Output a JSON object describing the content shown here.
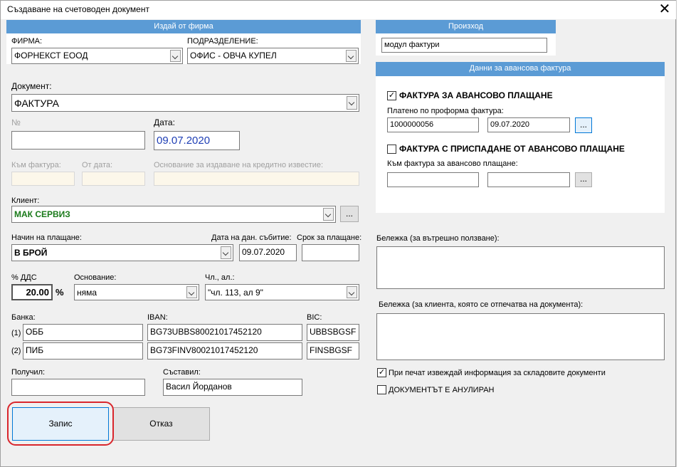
{
  "window": {
    "title": "Създаване на счетоводен документ"
  },
  "issued_from": {
    "header": "Издай от фирма",
    "firm_label": "ФИРМА:",
    "firm_value": "ФОРНЕКСТ ЕООД",
    "division_label": "ПОДРАЗДЕЛЕНИЕ:",
    "division_value": "ОФИС - ОВЧА КУПЕЛ"
  },
  "document": {
    "label": "Документ:",
    "value": "ФАКТУРА",
    "number_label": "№",
    "number_value": "",
    "date_label": "Дата:",
    "date_value": "09.07.2020",
    "to_invoice_label": "Към фактура:",
    "from_date_label": "От дата:",
    "credit_reason_label": "Основание за издаване на кредитно известие:"
  },
  "client": {
    "label": "Клиент:",
    "value": "МАК СЕРВИЗ",
    "browse": "..."
  },
  "payment": {
    "method_label": "Начин на плащане:",
    "method_value": "В БРОЙ",
    "tax_event_label": "Дата на дан. събитие:",
    "tax_event_value": "09.07.2020",
    "due_label": "Срок за плащане:",
    "due_value": ""
  },
  "vat": {
    "percent_label": "% ДДС",
    "percent_value": "20.00",
    "percent_sign": "%",
    "basis_label": "Основание:",
    "basis_value": "няма",
    "article_label": "Чл., ал.:",
    "article_value": "\"чл. 113, ал 9\""
  },
  "bank": {
    "bank_label": "Банка:",
    "iban_label": "IBAN:",
    "bic_label": "BIC:",
    "rows": [
      {
        "idx": "(1)",
        "bank": "ОББ",
        "iban": "BG73UBBS80021017452120",
        "bic": "UBBSBGSF"
      },
      {
        "idx": "(2)",
        "bank": "ПИБ",
        "iban": "BG73FINV80021017452120",
        "bic": "FINSBGSF"
      }
    ]
  },
  "received_by": {
    "label": "Получил:",
    "value": ""
  },
  "compiled_by": {
    "label": "Съставил:",
    "value": "Васил Йорданов"
  },
  "buttons": {
    "save": "Запис",
    "cancel": "Отказ"
  },
  "origin": {
    "header": "Произход",
    "value": "модул фактури"
  },
  "advance": {
    "header": "Данни за авансова фактура",
    "advance_checkbox_label": "ФАКТУРА ЗА АВАНСОВО ПЛАЩАНЕ",
    "advance_checked": "✓",
    "proforma_label": "Платено по проформа фактура:",
    "proforma_number": "1000000056",
    "proforma_date": "09.07.2020",
    "browse": "...",
    "deduct_checkbox_label": "ФАКТУРА С ПРИСПАДАНЕ ОТ АВАНСОВО ПЛАЩАНЕ",
    "deduct_checked": "",
    "to_advance_label": "Към фактура за авансово плащане:",
    "browse2": "..."
  },
  "notes": {
    "internal_label": "Бележка (за вътрешно ползване):",
    "internal_value": "",
    "client_label": "Бележка (за клиента, която се отпечатва на документа):",
    "client_value": ""
  },
  "print_option": {
    "label": "При печат извеждай информация за складовите документи",
    "checked": "✓"
  },
  "cancelled_option": {
    "label": "ДОКУМЕНТЪТ Е АНУЛИРАН",
    "checked": ""
  },
  "colors": {
    "accent": "#5b9bd5",
    "date_blue": "#1f3fb5",
    "client_green": "#1a7a1a",
    "highlight_red": "#d9262c"
  }
}
